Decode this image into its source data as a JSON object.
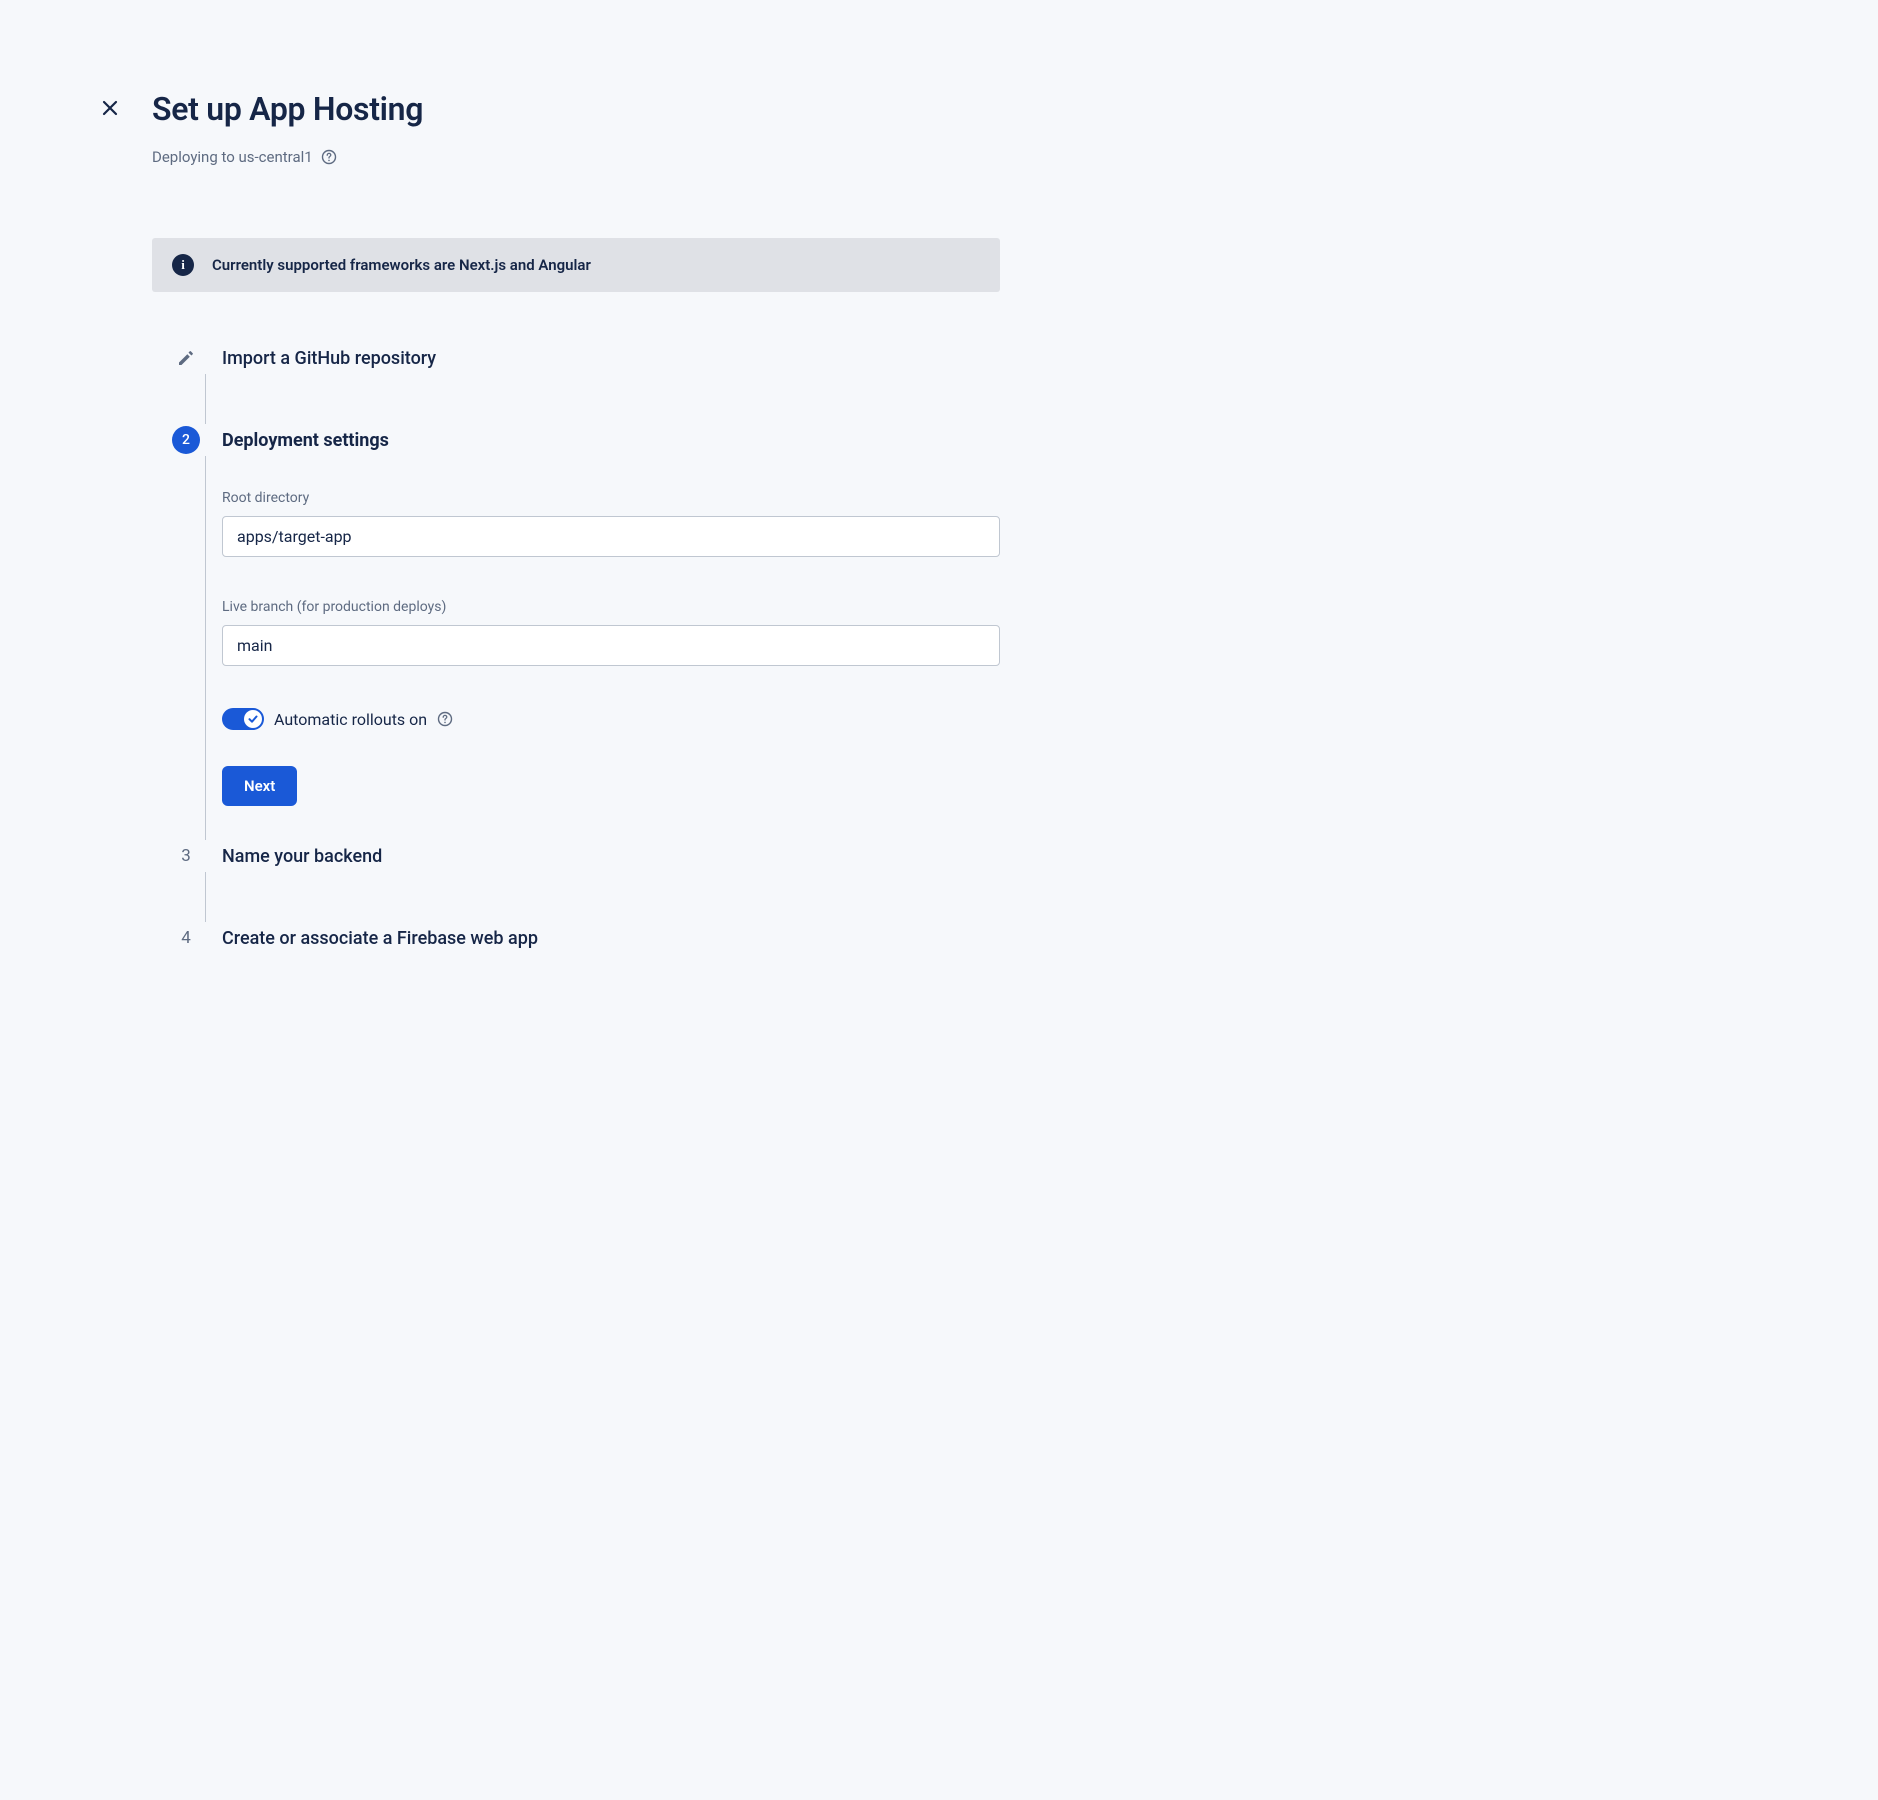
{
  "header": {
    "title": "Set up App Hosting",
    "subtitle": "Deploying to us-central1"
  },
  "banner": {
    "text": "Currently supported frameworks are Next.js and Angular"
  },
  "steps": {
    "step1": {
      "title": "Import a GitHub repository"
    },
    "step2": {
      "number": "2",
      "title": "Deployment settings",
      "root_dir_label": "Root directory",
      "root_dir_value": "apps/target-app",
      "live_branch_label": "Live branch (for production deploys)",
      "live_branch_value": "main",
      "toggle_label": "Automatic rollouts on",
      "next_label": "Next"
    },
    "step3": {
      "number": "3",
      "title": "Name your backend"
    },
    "step4": {
      "number": "4",
      "title": "Create or associate a Firebase web app"
    }
  }
}
